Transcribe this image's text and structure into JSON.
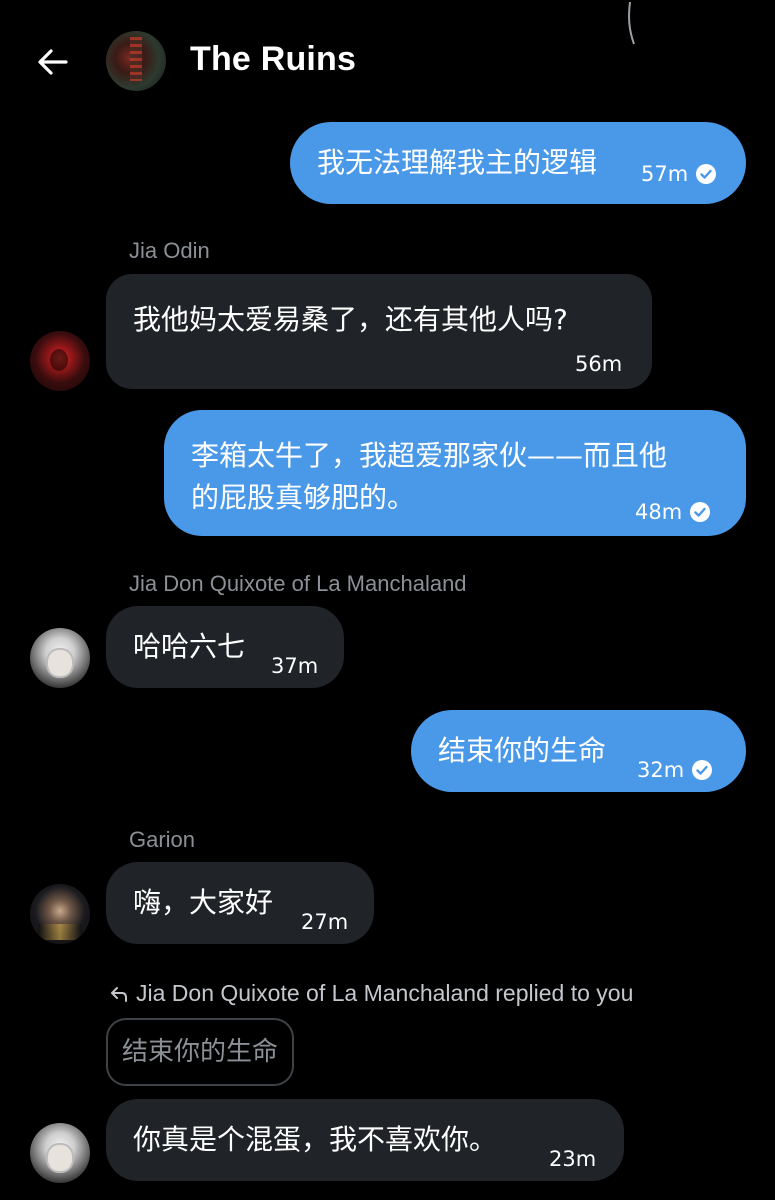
{
  "header": {
    "title": "The Ruins",
    "back_icon": "arrow-left-icon",
    "avatar_icon": "group-avatar"
  },
  "messages": [
    {
      "direction": "out",
      "text": "我无法理解我主的逻辑",
      "time": "57m",
      "status_icon": "read-check-icon"
    },
    {
      "direction": "in",
      "sender": "Jia Odin",
      "text": "我他妈太爱易桑了，还有其他人吗?",
      "time": "56m"
    },
    {
      "direction": "out",
      "text_line1": "李箱太牛了，我超爱那家伙——而且他",
      "text_line2": "的屁股真够肥的。",
      "time": "48m",
      "status_icon": "read-check-icon"
    },
    {
      "direction": "in",
      "sender": "Jia Don Quixote of La Manchaland",
      "text": "哈哈六七",
      "time": "37m"
    },
    {
      "direction": "out",
      "text": "结束你的生命",
      "time": "32m",
      "status_icon": "read-check-icon"
    },
    {
      "direction": "in",
      "sender": "Garion",
      "text": "嗨，大家好",
      "time": "27m"
    },
    {
      "direction": "in",
      "reply_label": "Jia Don Quixote of La Manchaland replied to you",
      "quoted": "结束你的生命",
      "text": "你真是个混蛋，我不喜欢你。",
      "time": "23m"
    }
  ],
  "colors": {
    "outgoing": "#4a99e9",
    "incoming": "#202327",
    "background": "#000000"
  }
}
